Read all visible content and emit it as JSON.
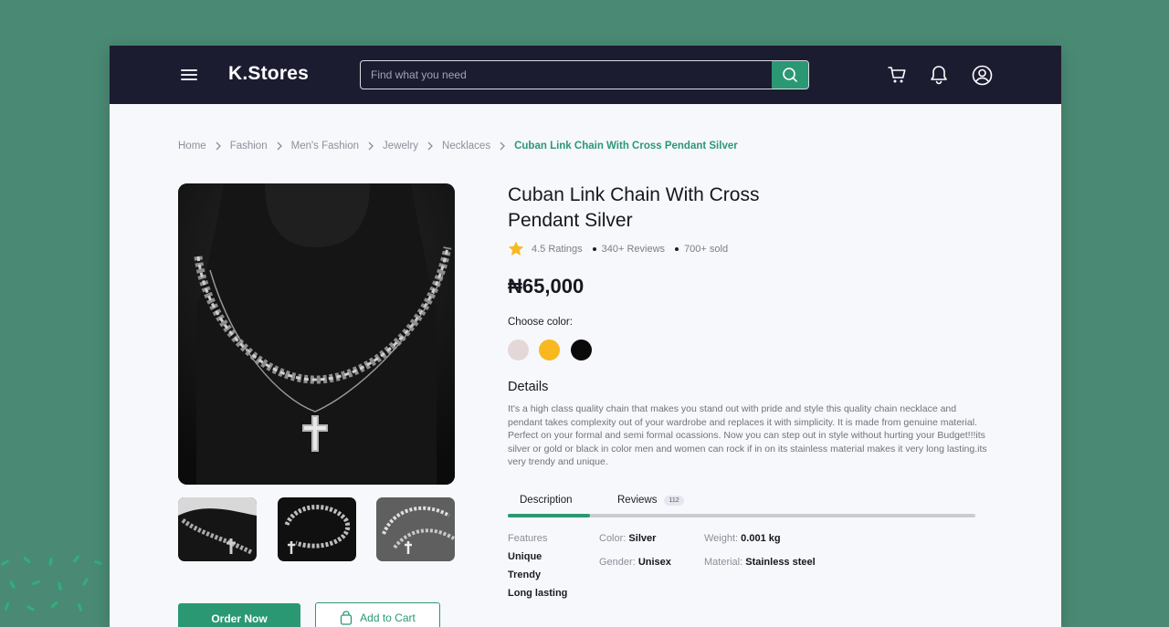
{
  "app": {
    "logo": "K.Stores"
  },
  "search": {
    "placeholder": "Find what you need"
  },
  "icons": {
    "menu": "hamburger-menu-icon",
    "search": "search-icon",
    "cart": "cart-icon",
    "notifications": "bell-icon",
    "profile": "user-circle-icon"
  },
  "breadcrumb": {
    "items": [
      "Home",
      "Fashion",
      "Men's Fashion",
      "Jewelry",
      "Necklaces"
    ],
    "current": "Cuban Link Chain With Cross Pendant Silver"
  },
  "product": {
    "title_line1": "Cuban Link Chain With Cross",
    "title_line2": "Pendant Silver",
    "rating": "4.5 Ratings",
    "reviews": "340+ Reviews",
    "sold": "700+ sold",
    "price": "₦65,000",
    "choose_color_label": "Choose color:",
    "colors": [
      "#e3d7d8",
      "#f7b820",
      "#0a0a0a"
    ],
    "details_title": "Details",
    "details_text": "It's a high class quality chain that makes you stand out with pride and style this quality chain necklace and pendant takes complexity out of your wardrobe and replaces it with simplicity. It is made from genuine material. Perfect on your formal and semi formal ocassions. Now you can step out in style without hurting your Budget!!!its silver or gold or black in color men and women can rock if in on its stainless material makes it very long lasting.its very trendy and unique."
  },
  "tabs": {
    "description": "Description",
    "reviews": "Reviews",
    "reviews_count": "112"
  },
  "features": {
    "label": "Features",
    "items": [
      "Unique",
      "Trendy",
      "Long lasting"
    ]
  },
  "specs": {
    "color_label": "Color",
    "color_value": "Silver",
    "gender_label": "Gender",
    "gender_value": "Unisex",
    "weight_label": "Weight",
    "weight_value": "0.001 kg",
    "material_label": "Material",
    "material_value": "Stainless steel"
  },
  "actions": {
    "order_now": "Order Now",
    "add_to_cart": "Add to Cart"
  },
  "theme": {
    "accent": "#2b9874",
    "topbar": "#1b1c30",
    "background": "#4a8a74"
  }
}
